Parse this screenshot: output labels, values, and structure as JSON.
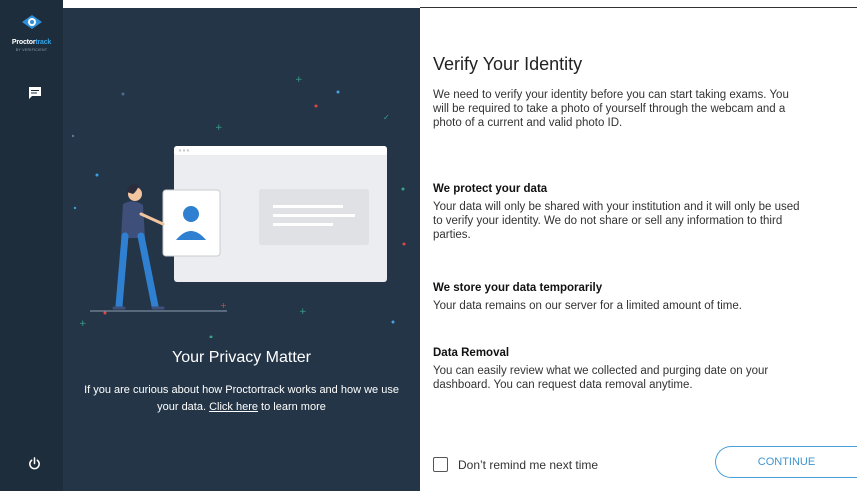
{
  "sidebar": {
    "logo_text_a": "Proctor",
    "logo_text_b": "track",
    "logo_sub": "BY VERIFICIENT"
  },
  "left_panel": {
    "title": "Your Privacy Matter",
    "text_before": "If you are curious about how Proctortrack works and how we use your data. ",
    "link_text": "Click here",
    "text_after": " to learn more"
  },
  "main": {
    "title": "Verify Your Identity",
    "intro": "We need to verify your identity before you can start taking exams. You will be required to take a photo of yourself through the webcam and a photo of a current and valid photo ID.",
    "sections": [
      {
        "title": "We protect your data",
        "text": "Your data will only be shared with your institution and it will only be used to verify your identity. We do not share or sell any information to third parties."
      },
      {
        "title": "We store your data temporarily",
        "text": "Your data remains on our server for a limited amount of time."
      },
      {
        "title": "Data Removal",
        "text": "You can easily review what we collected and purging date on your dashboard. You can request data removal anytime."
      }
    ],
    "remind_label": "Don’t remind me next time",
    "continue_label": "CONTINUE"
  },
  "colors": {
    "sidebar_bg": "#1d2d3c",
    "panel_bg": "#233547",
    "accent": "#33a3e8"
  }
}
